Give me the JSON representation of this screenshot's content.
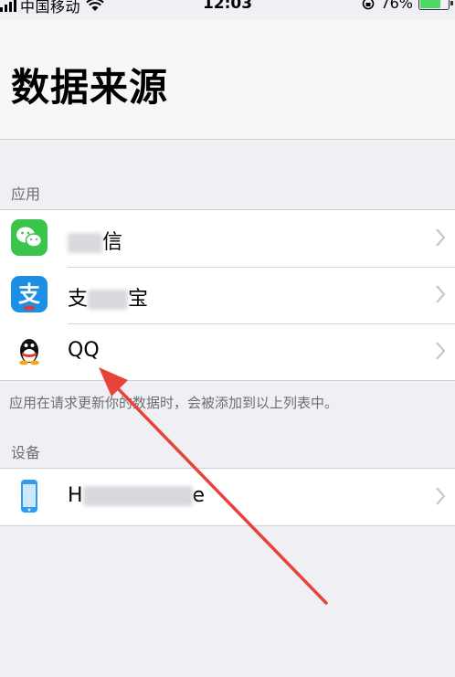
{
  "status_bar": {
    "carrier": "中国移动",
    "time": "12:03",
    "battery": "76%",
    "battery_level": 0.76
  },
  "header": {
    "title": "数据来源"
  },
  "sections": {
    "apps": {
      "header": "应用",
      "items": [
        {
          "label_start": "",
          "label_end": "信",
          "icon": "wechat-icon"
        },
        {
          "label_start": "支",
          "label_end": "宝",
          "icon": "alipay-icon"
        },
        {
          "label_start": "QQ",
          "label_end": "",
          "icon": "qq-icon"
        }
      ],
      "footer": "应用在请求更新你的数据时，会被添加到以上列表中。"
    },
    "devices": {
      "header": "设备",
      "items": [
        {
          "label_start": "H",
          "label_end": "e",
          "icon": "iphone-icon"
        }
      ]
    }
  },
  "colors": {
    "background": "#efeff4",
    "wechat_green": "#3bc44b",
    "alipay_blue": "#1a8fe3",
    "battery_green": "#4cd964",
    "annotation_red": "#e8433b"
  }
}
